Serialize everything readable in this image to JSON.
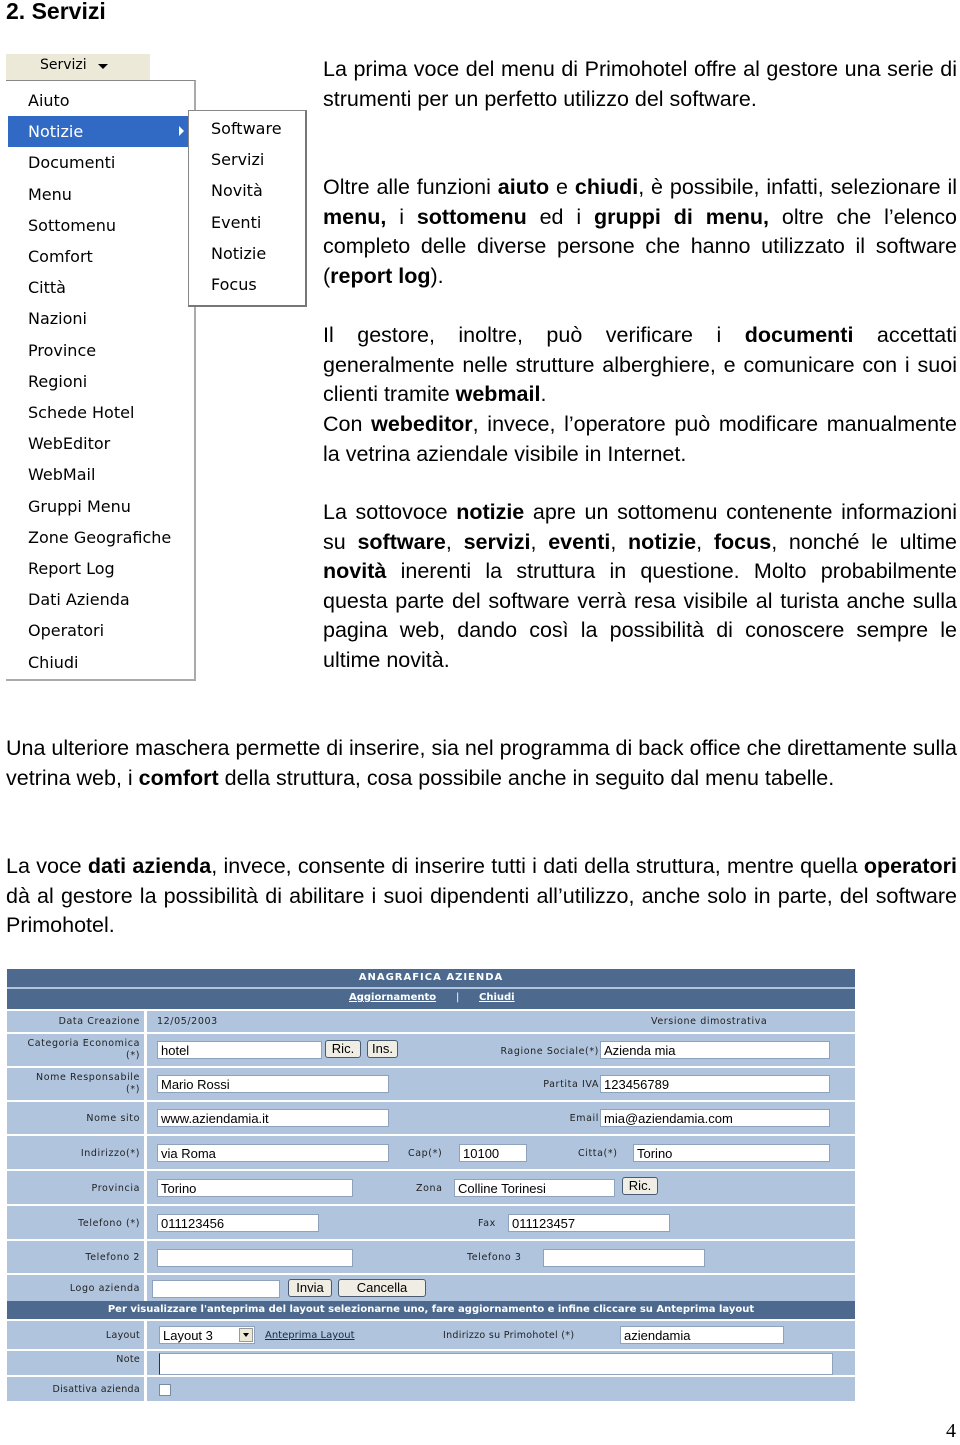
{
  "section_title": "2. Servizi",
  "menu": {
    "top_label": "Servizi",
    "items": [
      "Aiuto",
      "Notizie",
      "Documenti",
      "Menu",
      "Sottomenu",
      "Comfort",
      "Città",
      "Nazioni",
      "Province",
      "Regioni",
      "Schede Hotel",
      "WebEditor",
      "WebMail",
      "Gruppi Menu",
      "Zone Geografiche",
      "Report Log",
      "Dati Azienda",
      "Operatori",
      "Chiudi"
    ],
    "active_item": "Notizie",
    "submenu": [
      "Software",
      "Servizi",
      "Novità",
      "Eventi",
      "Notizie",
      "Focus"
    ]
  },
  "paragraphs": {
    "p1": "La prima voce del menu di Primohotel offre al gestore una serie di strumenti per un perfetto utilizzo del software.",
    "p2": [
      {
        "t": "Oltre alle funzioni "
      },
      {
        "b": "aiuto"
      },
      {
        "t": " e "
      },
      {
        "b": "chiudi"
      },
      {
        "t": ", è possibile, infatti, selezionare il "
      },
      {
        "b": "menu, "
      },
      {
        "t": "i "
      },
      {
        "b": "sottomenu"
      },
      {
        "t": " ed i "
      },
      {
        "b": "gruppi di menu,"
      },
      {
        "t": " oltre che l’elenco completo delle diverse persone che hanno utilizzato il software ("
      },
      {
        "b": "report log"
      },
      {
        "t": ")."
      }
    ],
    "p3": [
      {
        "t": "Il gestore, inoltre, può verificare i "
      },
      {
        "b": "documenti"
      },
      {
        "t": " accettati generalmente nelle strutture alberghiere,  e comunicare con i suoi clienti tramite "
      },
      {
        "b": "webmail"
      },
      {
        "t": "."
      }
    ],
    "p4": [
      {
        "t": "Con "
      },
      {
        "b": "webeditor"
      },
      {
        "t": ", invece, l’operatore può modificare manualmente la vetrina aziendale visibile in Internet."
      }
    ],
    "p5": [
      {
        "t": "La sottovoce "
      },
      {
        "b": "notizie"
      },
      {
        "t": " apre un sottomenu contenente informazioni su "
      },
      {
        "b": "software"
      },
      {
        "t": ", "
      },
      {
        "b": "servizi"
      },
      {
        "t": ", "
      },
      {
        "b": "eventi"
      },
      {
        "t": ", "
      },
      {
        "b": "notizie"
      },
      {
        "t": ", "
      },
      {
        "b": "focus"
      },
      {
        "t": ",  nonché le ultime "
      },
      {
        "b": "novità"
      },
      {
        "t": " inerenti la struttura in questione. Molto probabilmente questa parte del software verrà resa visibile al turista anche sulla pagina web, dando così la possibilità di conoscere sempre le ultime novità."
      }
    ],
    "p6": [
      {
        "t": "Una ulteriore maschera permette di inserire, sia nel programma di back office che direttamente sulla vetrina web, i "
      },
      {
        "b": "comfort"
      },
      {
        "t": " della struttura, cosa possibile anche in seguito dal menu tabelle."
      }
    ],
    "p7": [
      {
        "t": "La voce "
      },
      {
        "b": "dati azienda"
      },
      {
        "t": ", invece, consente di inserire tutti i dati della struttura, mentre quella "
      },
      {
        "b": "operatori"
      },
      {
        "t": " dà al gestore la possibilità di abilitare i suoi dipendenti all’utilizzo, anche solo in parte, del software Primohotel."
      }
    ]
  },
  "form": {
    "title": "ANAGRAFICA AZIENDA",
    "links": {
      "update": "Aggiornamento",
      "separator": "|",
      "close": "Chiudi"
    },
    "data_creazione": {
      "label": "Data Creazione",
      "value": "12/05/2003"
    },
    "version_note": "Versione dimostrativa",
    "categoria": {
      "label": "Categoria Economica",
      "label2": "(*)",
      "value": "hotel",
      "btn_search": "Ric.",
      "btn_insert": "Ins."
    },
    "ragione_sociale": {
      "label": "Ragione Sociale(*)",
      "value": "Azienda mia"
    },
    "responsabile": {
      "label": "Nome Responsabile",
      "label2": "(*)",
      "value": "Mario Rossi"
    },
    "partita_iva": {
      "label": "Partita IVA",
      "value": "123456789"
    },
    "nome_sito": {
      "label": "Nome sito",
      "value": "www.aziendamia.it"
    },
    "email": {
      "label": "Email",
      "value": "mia@aziendamia.com"
    },
    "indirizzo": {
      "label": "Indirizzo(*)",
      "value": "via Roma"
    },
    "cap": {
      "label": "Cap(*)",
      "value": "10100"
    },
    "citta": {
      "label": "Citta(*)",
      "value": "Torino"
    },
    "provincia": {
      "label": "Provincia",
      "value": "Torino"
    },
    "zona": {
      "label": "Zona",
      "value": "Colline Torinesi",
      "btn_search": "Ric."
    },
    "telefono": {
      "label": "Telefono (*)",
      "value": "011123456"
    },
    "fax": {
      "label": "Fax",
      "value": "011123457"
    },
    "telefono2": {
      "label": "Telefono 2",
      "value": ""
    },
    "telefono3": {
      "label": "Telefono 3",
      "value": ""
    },
    "logo": {
      "label": "Logo azienda",
      "value": "",
      "btn_send": "Invia",
      "btn_cancel": "Cancella"
    },
    "layout_hint": "Per visualizzare l'anteprima del layout selezionarne uno, fare aggiornamento e infine cliccare su Anteprima layout",
    "layout": {
      "label": "Layout",
      "value": "Layout 3",
      "preview_link": "Anteprima Layout"
    },
    "indirizzo_primohotel": {
      "label": "Indirizzo su Primohotel (*)",
      "value": "aziendamia"
    },
    "note": {
      "label": "Note",
      "value": ""
    },
    "disattiva": {
      "label": "Disattiva azienda",
      "checked": false
    }
  },
  "page_number": "4"
}
